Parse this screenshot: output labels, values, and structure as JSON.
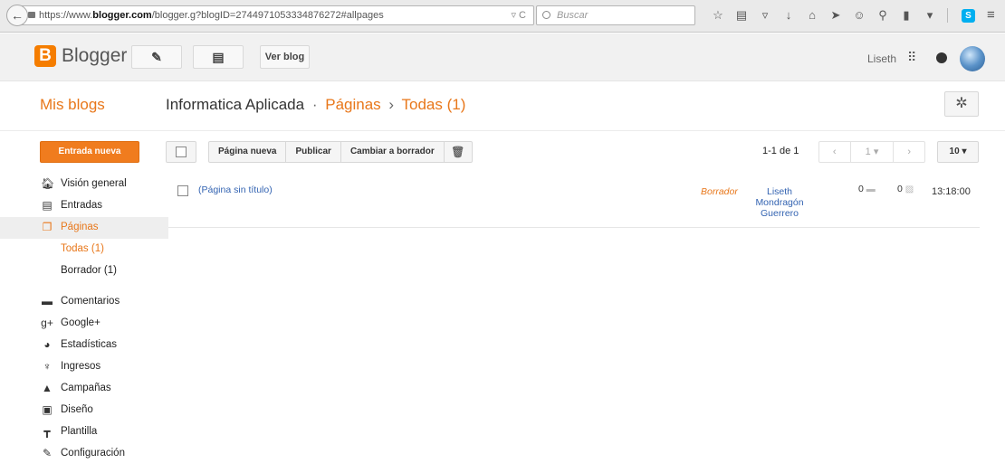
{
  "browser": {
    "url_prefix": "https://www.",
    "url_host": "blogger.com",
    "url_path": "/blogger.g?blogID=2744971053334876272#allpages",
    "search_placeholder": "Buscar"
  },
  "header": {
    "logo_letter": "B",
    "app_name": "Blogger",
    "view_blog": "Ver blog",
    "user": "Liseth"
  },
  "title_row": {
    "my_blogs": "Mis blogs",
    "blog_name": "Informatica Aplicada",
    "separator_dot": "·",
    "section": "Páginas",
    "separator_arrow": "›",
    "filter": "Todas (1)"
  },
  "sidebar": {
    "new_post": "Entrada nueva",
    "items": [
      {
        "label": "Visión general",
        "icon": "home-icon"
      },
      {
        "label": "Entradas",
        "icon": "posts-icon"
      },
      {
        "label": "Páginas",
        "icon": "pages-icon",
        "active": true
      }
    ],
    "sub_items": [
      {
        "label": "Todas (1)",
        "active": true
      },
      {
        "label": "Borrador (1)"
      }
    ],
    "items2": [
      {
        "label": "Comentarios",
        "icon": "comment-icon"
      },
      {
        "label": "Google+",
        "icon": "google-plus-icon"
      },
      {
        "label": "Estadísticas",
        "icon": "stats-icon"
      },
      {
        "label": "Ingresos",
        "icon": "trophy-icon"
      },
      {
        "label": "Campañas",
        "icon": "campaigns-icon"
      },
      {
        "label": "Diseño",
        "icon": "layout-icon"
      },
      {
        "label": "Plantilla",
        "icon": "template-icon"
      },
      {
        "label": "Configuración",
        "icon": "wrench-icon"
      }
    ]
  },
  "toolbar": {
    "new_page": "Página nueva",
    "publish": "Publicar",
    "revert_draft": "Cambiar a borrador",
    "page_info": "1-1 de 1",
    "prev": "‹",
    "page_num": "1",
    "next": "›",
    "per_page": "10"
  },
  "rows": [
    {
      "title": "(Página sin título)",
      "status": "Borrador",
      "author_line1": "Liseth",
      "author_line2": "Mondragón",
      "author_line3": "Guerrero",
      "comments": "0",
      "views": "0",
      "time": "13:18:00"
    }
  ]
}
